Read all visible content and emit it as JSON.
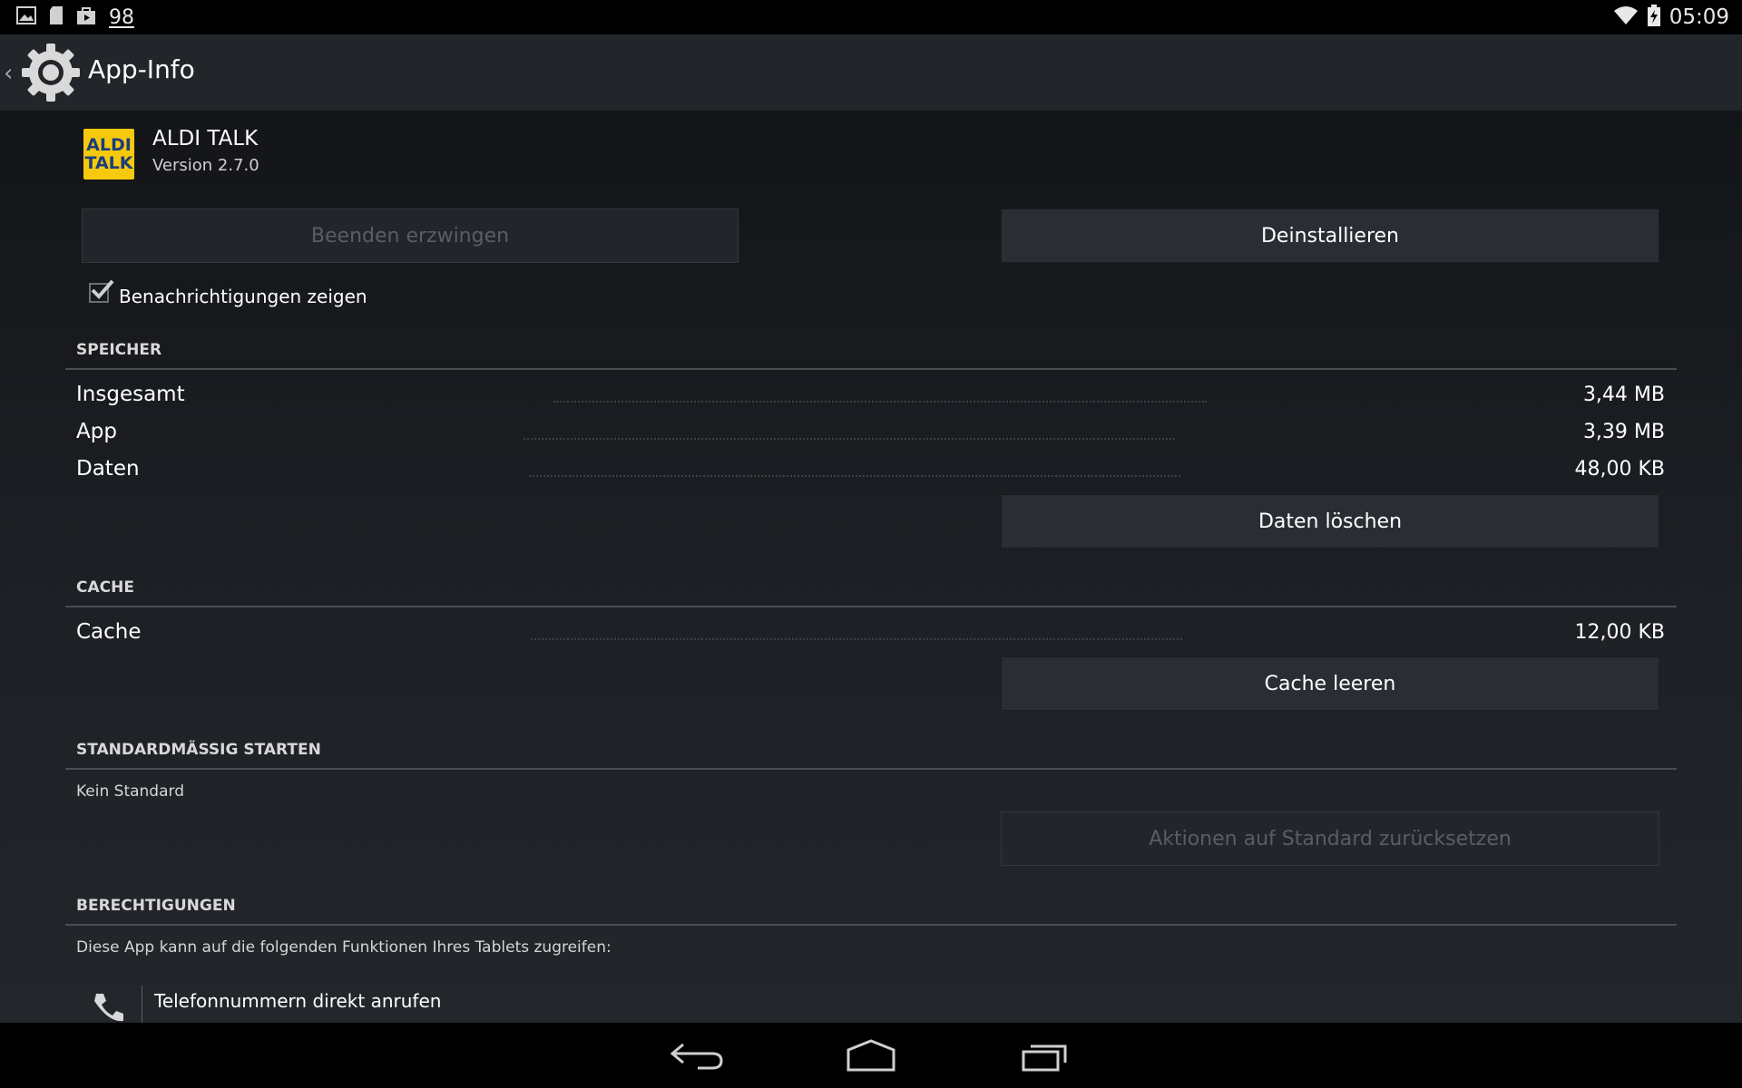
{
  "status_bar": {
    "notification_count": "98",
    "time": "05:09",
    "icons": [
      "image-icon",
      "sd-card-icon",
      "store-bag-icon",
      "wifi-icon",
      "battery-icon"
    ]
  },
  "action_bar": {
    "title": "App-Info",
    "icon": "settings-gear-icon"
  },
  "app": {
    "logo_line1": "ALDI",
    "logo_line2": "TALK",
    "name": "ALDI TALK",
    "version": "Version 2.7.0"
  },
  "buttons": {
    "force_stop": "Beenden erzwingen",
    "uninstall": "Deinstallieren",
    "clear_data": "Daten löschen",
    "clear_cache": "Cache leeren",
    "reset_defaults": "Aktionen auf Standard zurücksetzen"
  },
  "notifications_checkbox": {
    "label": "Benachrichtigungen zeigen",
    "checked": true
  },
  "storage": {
    "header": "SPEICHER",
    "rows": [
      {
        "label": "Insgesamt",
        "value": "3,44 MB"
      },
      {
        "label": "App",
        "value": "3,39 MB"
      },
      {
        "label": "Daten",
        "value": "48,00 KB"
      }
    ]
  },
  "cache": {
    "header": "CACHE",
    "label": "Cache",
    "value": "12,00 KB"
  },
  "launch_default": {
    "header": "STANDARDMÄSSIG STARTEN",
    "text": "Kein Standard"
  },
  "permissions": {
    "header": "BERECHTIGUNGEN",
    "intro": "Diese App kann auf die folgenden Funktionen Ihres Tablets zugreifen:",
    "items": [
      {
        "label": "Telefonnummern direkt anrufen",
        "icon": "phone-icon"
      }
    ]
  },
  "colors": {
    "accent_yellow": "#f7c90d",
    "logo_text_blue": "#1a3d7a",
    "background": "#1e2126",
    "action_bar": "#22252a"
  }
}
